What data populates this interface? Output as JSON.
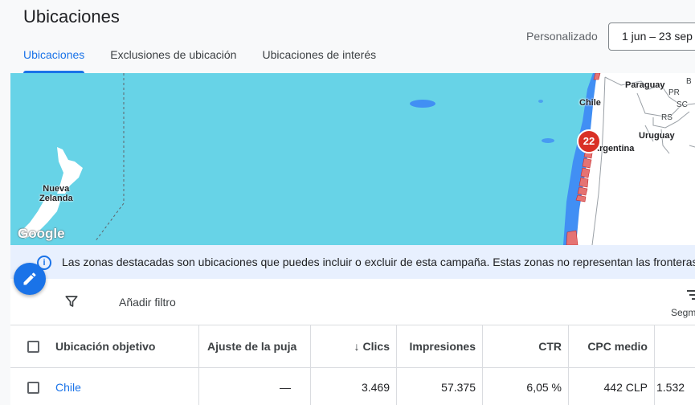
{
  "header": {
    "title": "Ubicaciones",
    "date_label": "Personalizado",
    "date_range": "1 jun – 23 sep"
  },
  "tabs": [
    {
      "label": "Ubicaciones",
      "active": true
    },
    {
      "label": "Exclusiones de ubicación",
      "active": false
    },
    {
      "label": "Ubicaciones de interés",
      "active": false
    }
  ],
  "map": {
    "labels": {
      "nz": "Nueva\nZelanda",
      "chile": "Chile",
      "paraguay": "Paraguay",
      "argentina": "Argentina",
      "uruguay": "Uruguay",
      "pr": "PR",
      "sc": "SC",
      "rs": "RS",
      "b": "B"
    },
    "cluster_count": "22",
    "google": "Google",
    "water_color": "#67d3e7",
    "land_color": "#ffffff",
    "highlight_color": "#e57373"
  },
  "info": {
    "text": "Las zonas destacadas son ubicaciones que puedes incluir o excluir de esta campaña. Estas zonas no representan las fronteras"
  },
  "filter": {
    "add_filter": "Añadir filtro",
    "segment": "Segm"
  },
  "table": {
    "columns": {
      "location": "Ubicación objetivo",
      "bid_adj": "Ajuste de la puja",
      "clicks": "Clics",
      "impressions": "Impresiones",
      "ctr": "CTR",
      "cpc": "CPC medio"
    },
    "rows": [
      {
        "location": "Chile",
        "bid_adj": "—",
        "clicks": "3.469",
        "impressions": "57.375",
        "ctr": "6,05 %",
        "cpc": "442 CLP",
        "cost": "1.532"
      }
    ]
  }
}
